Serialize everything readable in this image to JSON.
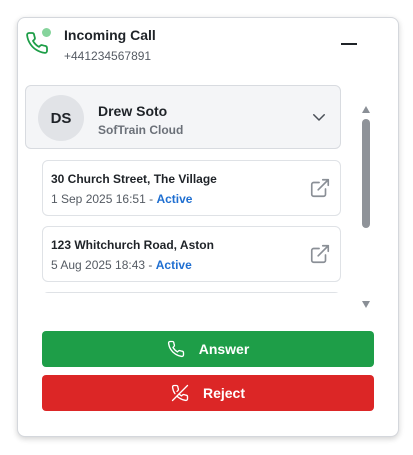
{
  "call": {
    "title": "Incoming Call",
    "number": "+441234567891"
  },
  "contact": {
    "initials": "DS",
    "name": "Drew Soto",
    "company": "SofTrain Cloud"
  },
  "sessions": [
    {
      "address": "30 Church Street, The Village",
      "datetime": "1 Sep 2025 16:51",
      "separator": " - ",
      "status": "Active"
    },
    {
      "address": "123 Whitchurch Road, Aston",
      "datetime": "5 Aug 2025 18:43",
      "separator": " - ",
      "status": "Active"
    },
    {
      "address": "",
      "datetime": "",
      "separator": "",
      "status": ""
    }
  ],
  "actions": {
    "answer_label": "Answer",
    "reject_label": "Reject"
  },
  "colors": {
    "answer": "#1e9e48",
    "reject": "#dc2626",
    "status_active": "#1f6fd1",
    "live_dot": "#86d49c",
    "phone_icon": "#1e9e48"
  },
  "icons": {
    "call": "phone-icon",
    "minimize": "minimize-icon",
    "expand": "chevron-down-icon",
    "open": "external-link-icon",
    "answer": "phone-icon",
    "reject": "phone-off-icon"
  }
}
